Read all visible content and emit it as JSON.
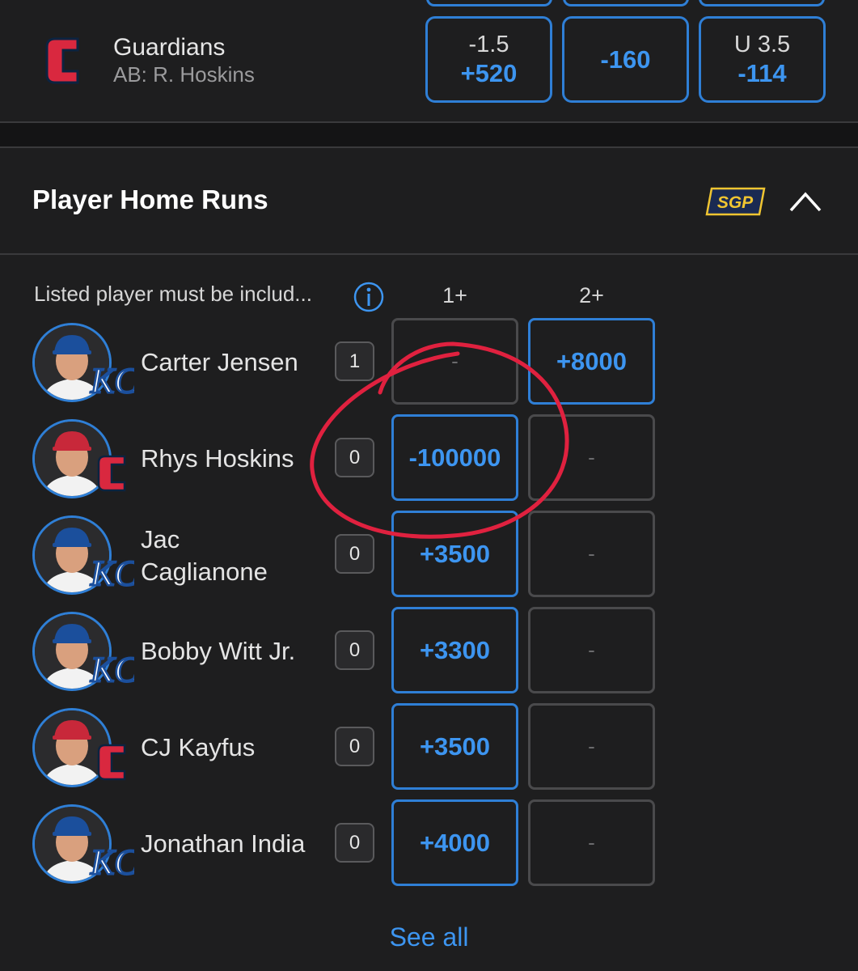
{
  "game": {
    "team_name": "Guardians",
    "at_bat": "AB: R. Hoskins",
    "odds": [
      {
        "line": "-1.5",
        "price": "+520"
      },
      {
        "line": "",
        "price": "-160"
      },
      {
        "line": "U 3.5",
        "price": "-114"
      }
    ]
  },
  "section": {
    "title": "Player Home Runs",
    "sgp_label": "SGP",
    "note": "Listed player must be includ...",
    "columns": [
      "1+",
      "2+"
    ]
  },
  "players": [
    {
      "name": "Carter Jensen",
      "team": "KC",
      "count": "1",
      "odds": [
        "-",
        "+8000"
      ],
      "active": [
        false,
        true
      ]
    },
    {
      "name": "Rhys Hoskins",
      "team": "CLE",
      "count": "0",
      "odds": [
        "-100000",
        "-"
      ],
      "active": [
        true,
        false
      ]
    },
    {
      "name": "Jac\nCaglianone",
      "team": "KC",
      "count": "0",
      "odds": [
        "+3500",
        "-"
      ],
      "active": [
        true,
        false
      ]
    },
    {
      "name": "Bobby Witt Jr.",
      "team": "KC",
      "count": "0",
      "odds": [
        "+3300",
        "-"
      ],
      "active": [
        true,
        false
      ]
    },
    {
      "name": "CJ Kayfus",
      "team": "CLE",
      "count": "0",
      "odds": [
        "+3500",
        "-"
      ],
      "active": [
        true,
        false
      ]
    },
    {
      "name": "Jonathan India",
      "team": "KC",
      "count": "0",
      "odds": [
        "+4000",
        "-"
      ],
      "active": [
        true,
        false
      ]
    }
  ],
  "see_all": "See all",
  "colors": {
    "accent": "#3d95f0",
    "border": "#2f7fd6",
    "annotation": "#e0213f",
    "kc_blue": "#1b4f9c",
    "cle_red": "#d9283f"
  }
}
